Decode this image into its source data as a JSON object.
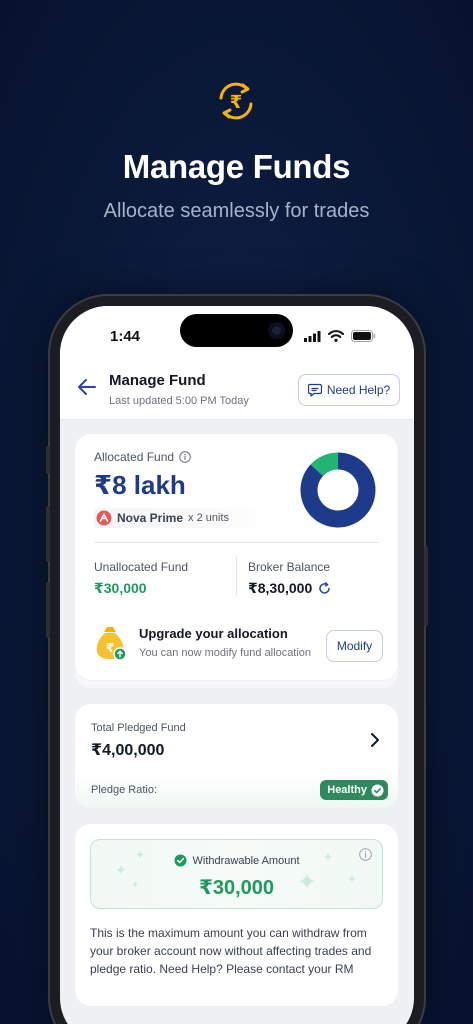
{
  "hero": {
    "title": "Manage Funds",
    "subtitle": "Allocate seamlessly for trades",
    "icon": "rupee-exchange-icon"
  },
  "status_bar": {
    "time": "1:44"
  },
  "header": {
    "title": "Manage Fund",
    "last_updated": "Last updated 5:00 PM Today",
    "help_label": "Need Help?"
  },
  "allocated": {
    "label": "Allocated Fund",
    "value": "₹8 lakh",
    "plan_name": "Nova Prime",
    "plan_units": "x 2 units",
    "donut": {
      "allocated_fraction": 0.87,
      "unallocated_fraction": 0.13,
      "colors": {
        "allocated": "#1e3a8a",
        "unallocated": "#22b573"
      }
    }
  },
  "unallocated": {
    "label": "Unallocated Fund",
    "value": "₹30,000"
  },
  "broker": {
    "label": "Broker Balance",
    "value": "₹8,30,000"
  },
  "upgrade": {
    "title": "Upgrade your allocation",
    "subtitle": "You can now modify fund allocation",
    "button_label": "Modify"
  },
  "pledge": {
    "label": "Total Pledged Fund",
    "value": "₹4,00,000",
    "ratio_label": "Pledge Ratio:",
    "status": "Healthy"
  },
  "withdraw": {
    "label": "Withdrawable Amount",
    "value": "₹30,000",
    "description": "This is the maximum amount you can withdraw from your broker account now without affecting trades and pledge ratio. Need Help? Please contact your RM"
  },
  "colors": {
    "primary": "#1e3a8a",
    "positive": "#1e9a5e",
    "background": "#0a1938"
  }
}
